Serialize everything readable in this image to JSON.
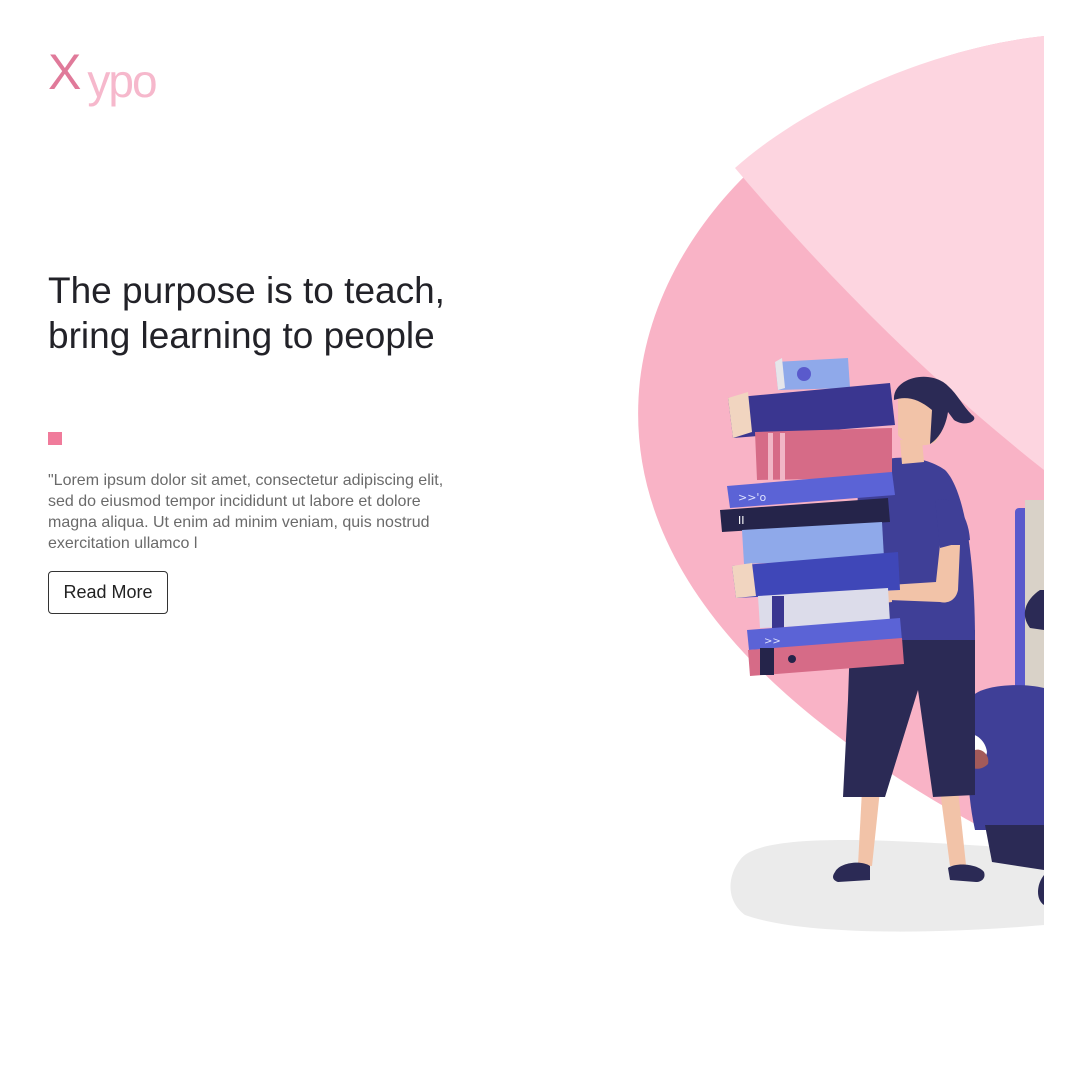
{
  "logo": {
    "first_letter": "X",
    "rest": "ypo"
  },
  "hero": {
    "headline": "The purpose is to teach, bring learning to people",
    "body": "\"Lorem ipsum dolor sit amet, consectetur adipiscing elit, sed do eiusmod tempor incididunt ut labore et dolore magna aliqua. Ut enim ad minim veniam, quis nostrud exercitation ullamco l",
    "cta_label": "Read More"
  },
  "illustration": {
    "subject": "person-carrying-stack-of-books",
    "book_spine_marks": [
      ">>'o",
      "II",
      ">>"
    ]
  },
  "colors": {
    "accent_pink": "#f07b9b",
    "blob_light": "#fdd5e0",
    "blob_mid": "#f9b3c6",
    "navy": "#2b2a55",
    "indigo": "#3f3f97"
  }
}
